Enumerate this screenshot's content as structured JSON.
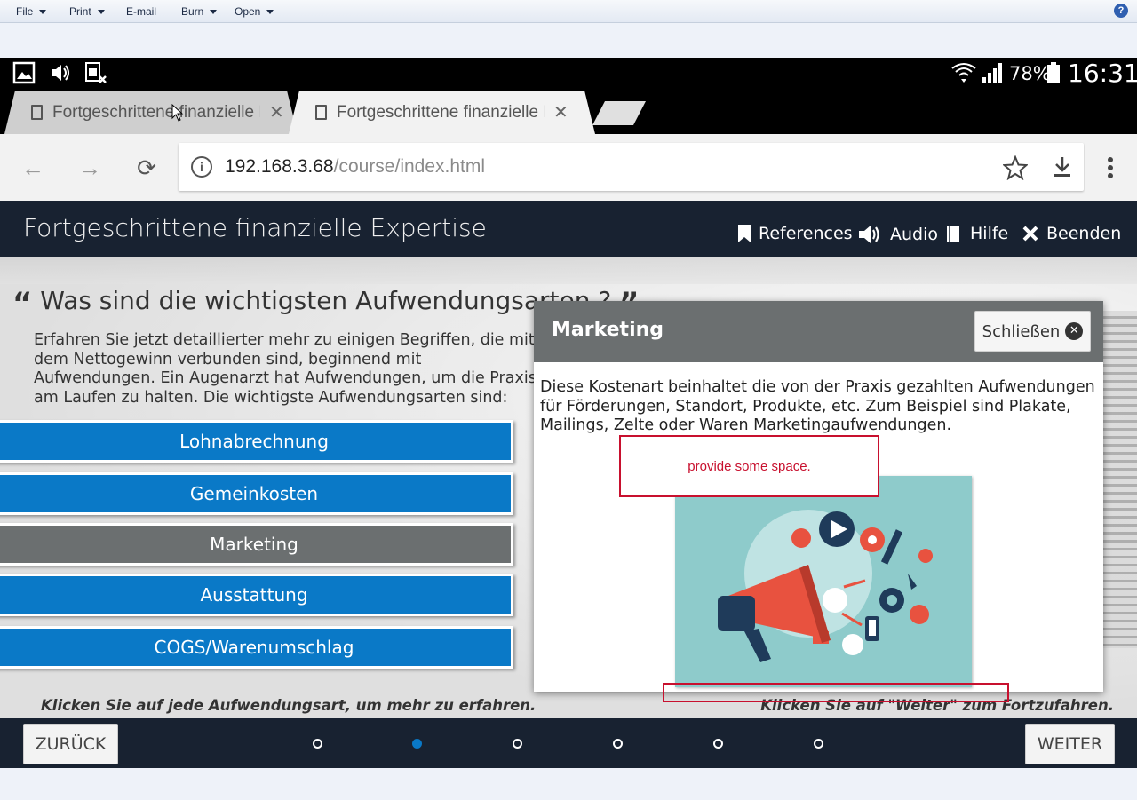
{
  "viewer": {
    "menus": [
      {
        "label": "File",
        "dropdown": true
      },
      {
        "label": "Print",
        "dropdown": true
      },
      {
        "label": "E-mail",
        "dropdown": false
      },
      {
        "label": "Burn",
        "dropdown": true
      },
      {
        "label": "Open",
        "dropdown": true
      }
    ],
    "help_icon": "question-circle-icon"
  },
  "statusbar": {
    "left_icons": [
      "image-icon",
      "volume-icon",
      "sim-error-icon"
    ],
    "right_icons": [
      "wifi-icon",
      "signal-icon",
      "battery-icon"
    ],
    "battery": "78%",
    "time": "16:31"
  },
  "browser": {
    "tabs": [
      {
        "title": "Fortgeschrittene finanzielle Expertise",
        "active": false
      },
      {
        "title": "Fortgeschrittene finanzielle Expertise",
        "active": true
      }
    ],
    "url_host": "192.168.3.68",
    "url_path": "/course/index.html"
  },
  "course": {
    "title": "Fortgeschrittene finanzielle Expertise",
    "nav": [
      {
        "label": "References",
        "icon": "bookmark-icon"
      },
      {
        "label": "Audio",
        "icon": "speaker-icon"
      },
      {
        "label": "Hilfe",
        "icon": "book-icon"
      },
      {
        "label": "Beenden",
        "icon": "close-x-icon"
      }
    ],
    "question": "Was sind die wichtigsten Aufwendungsarten ?",
    "intro": "Erfahren Sie jetzt detaillierter mehr zu einigen Begriffen, die mit dem Nettogewinn verbunden sind, beginnend mit Aufwendungen. Ein Augenarzt hat Aufwendungen, um die Praxis am Laufen zu halten. Die wichtigste Aufwendungsarten sind:",
    "categories": [
      {
        "label": "Lohnabrechnung",
        "active": false
      },
      {
        "label": "Gemeinkosten",
        "active": false
      },
      {
        "label": "Marketing",
        "active": true
      },
      {
        "label": "Ausstattung",
        "active": false
      },
      {
        "label": "COGS/Warenumschlag",
        "active": false
      }
    ],
    "hint_left": "Klicken Sie auf jede Aufwendungsart, um mehr zu erfahren.",
    "hint_right": "Klicken Sie auf \"Weiter\" zum Fortzufahren.",
    "popup": {
      "title": "Marketing",
      "close_label": "Schließen",
      "body": "Diese Kostenart beinhaltet die von der Praxis gezahlten Aufwendungen für Förderungen, Standort, Produkte, etc. Zum Beispiel sind Plakate, Mailings, Zelte oder Waren Marketingaufwendungen.",
      "image": "megaphone-marketing-illustration"
    },
    "annotation": "provide some space.",
    "footer": {
      "back_label": "ZURÜCK",
      "next_label": "WEITER",
      "pages": 6,
      "current_page": 2
    }
  },
  "colors": {
    "header_bg": "#182231",
    "button_blue": "#0a79c7",
    "button_active": "#6b6f70",
    "annotation_red": "#c8102e"
  }
}
